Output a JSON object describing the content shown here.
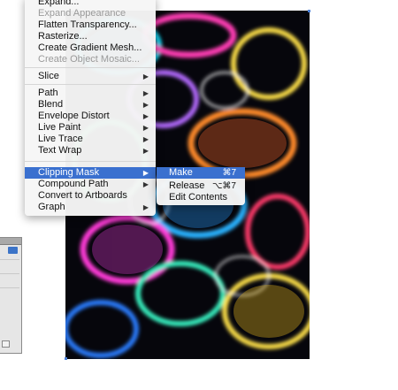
{
  "menu": {
    "items": [
      {
        "label": "Expand...",
        "disabled": false,
        "submenu": false
      },
      {
        "label": "Expand Appearance",
        "disabled": true,
        "submenu": false
      },
      {
        "label": "Flatten Transparency...",
        "disabled": false,
        "submenu": false
      },
      {
        "label": "Rasterize...",
        "disabled": false,
        "submenu": false
      },
      {
        "label": "Create Gradient Mesh...",
        "disabled": false,
        "submenu": false
      },
      {
        "label": "Create Object Mosaic...",
        "disabled": true,
        "submenu": false
      },
      {
        "label": "Slice",
        "disabled": false,
        "submenu": true
      },
      {
        "label": "Path",
        "disabled": false,
        "submenu": true
      },
      {
        "label": "Blend",
        "disabled": false,
        "submenu": true
      },
      {
        "label": "Envelope Distort",
        "disabled": false,
        "submenu": true
      },
      {
        "label": "Live Paint",
        "disabled": false,
        "submenu": true
      },
      {
        "label": "Live Trace",
        "disabled": false,
        "submenu": true
      },
      {
        "label": "Text Wrap",
        "disabled": false,
        "submenu": true
      },
      {
        "label": "Clipping Mask",
        "disabled": false,
        "submenu": true,
        "active": true
      },
      {
        "label": "Compound Path",
        "disabled": false,
        "submenu": true
      },
      {
        "label": "Convert to Artboards",
        "disabled": false,
        "submenu": false
      },
      {
        "label": "Graph",
        "disabled": false,
        "submenu": true
      }
    ],
    "arrow_glyph": "▶"
  },
  "submenu": {
    "items": [
      {
        "label": "Make",
        "shortcut": "⌘7",
        "active": true
      },
      {
        "label": "Release",
        "shortcut": "⌥⌘7",
        "active": false
      },
      {
        "label": "Edit Contents",
        "shortcut": "",
        "active": false
      }
    ]
  },
  "colors": {
    "highlight": "#3a70cf",
    "artwork_bg": "#06060c"
  }
}
